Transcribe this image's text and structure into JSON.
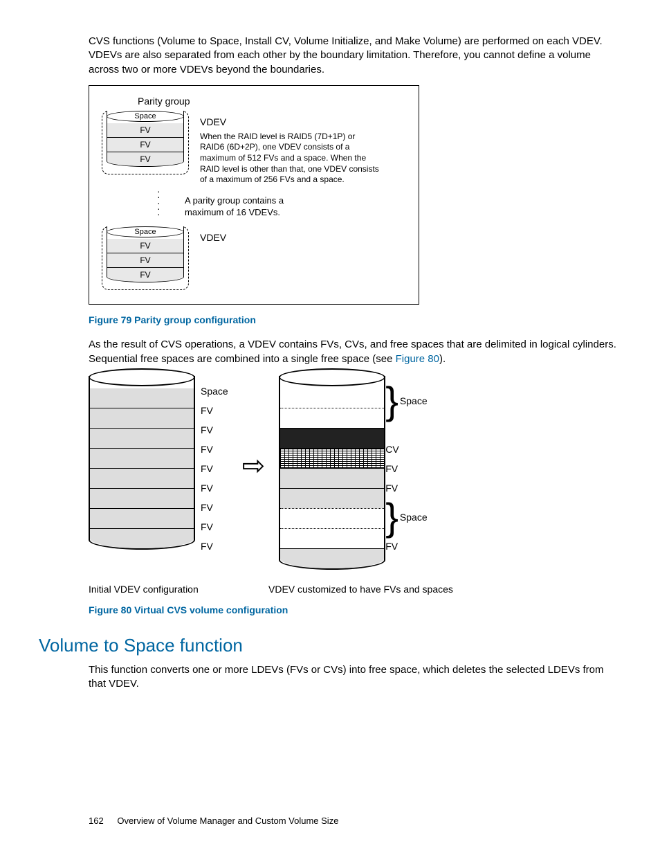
{
  "para1": "CVS functions (Volume to Space, Install CV, Volume Initialize, and Make Volume) are performed on each VDEV. VDEVs are also separated from each other by the boundary limitation. Therefore, you cannot define a volume across two or more VDEVs beyond the boundaries.",
  "fig79": {
    "parity_group_label": "Parity group",
    "vdev_label": "VDEV",
    "space_label": "Space",
    "fv_label": "FV",
    "vdev_desc": "When the RAID level is RAID5 (7D+1P) or RAID6 (6D+2P), one VDEV consists of a maximum of 512 FVs and a space. When the RAID level is other than that, one VDEV consists of a maximum of 256 FVs and a space.",
    "mid_text_l1": "A parity group contains a",
    "mid_text_l2": "maximum of 16 VDEVs.",
    "caption": "Figure 79 Parity group configuration"
  },
  "para2_pre": "As the result of CVS operations, a VDEV contains FVs, CVs, and free spaces that are delimited in logical cylinders. Sequential free spaces are combined into a single free space (see ",
  "para2_link": "Figure 80",
  "para2_post": ").",
  "fig80": {
    "left_labels": [
      "Space",
      "FV",
      "FV",
      "FV",
      "FV",
      "FV",
      "FV",
      "FV",
      "FV"
    ],
    "right_labels": [
      "Space",
      "CV",
      "FV",
      "FV",
      "Space",
      "FV"
    ],
    "left_caption": "Initial VDEV configuration",
    "right_caption": "VDEV customized to have FVs and spaces",
    "caption": "Figure 80 Virtual CVS volume configuration"
  },
  "section_heading": "Volume to Space function",
  "para3": "This function converts one or more LDEVs (FVs or CVs) into free space, which deletes the selected LDEVs from that VDEV.",
  "footer_page": "162",
  "footer_text": "Overview of Volume Manager and Custom Volume Size"
}
